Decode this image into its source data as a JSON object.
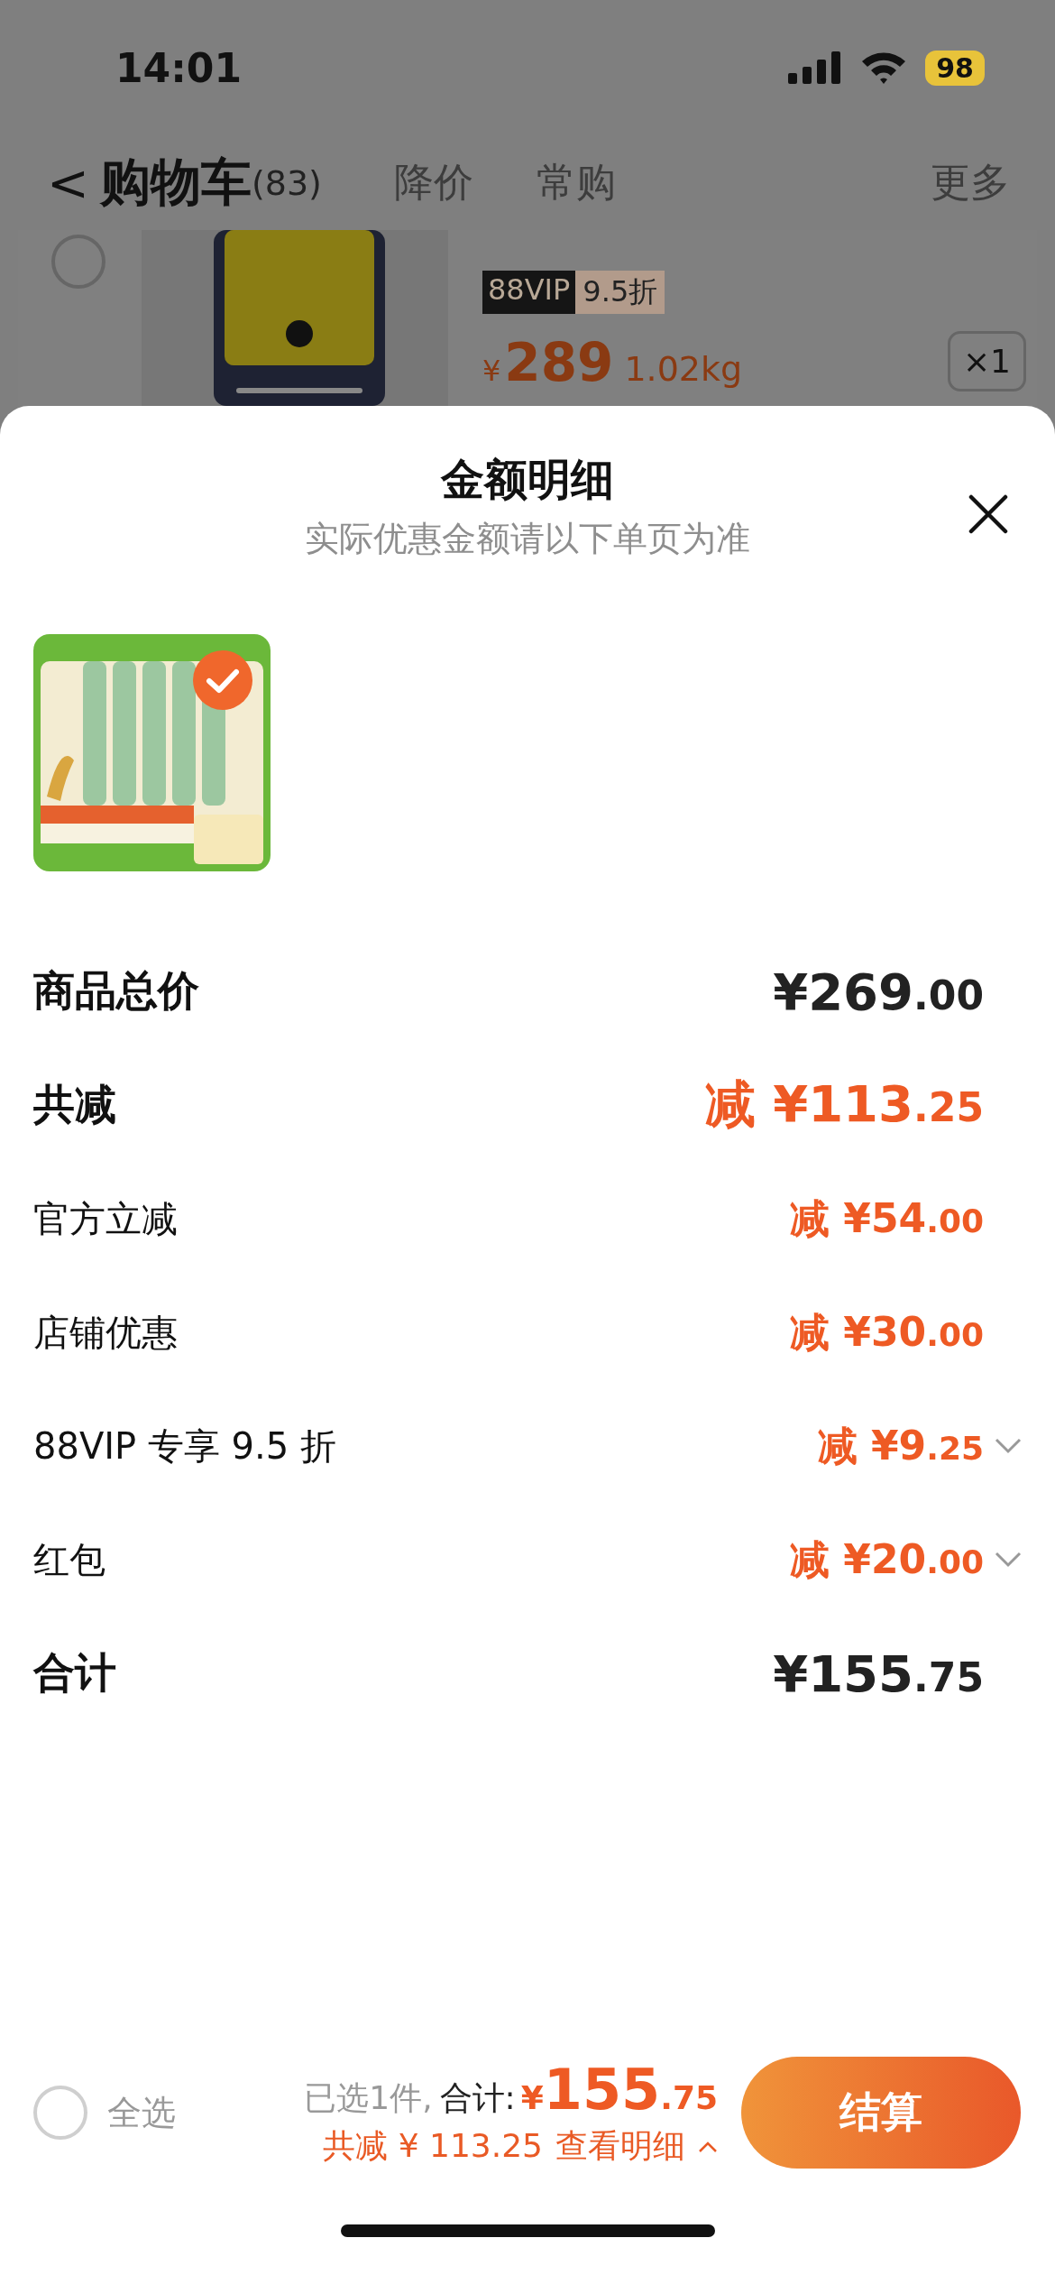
{
  "status_bar": {
    "time": "14:01",
    "battery": "98"
  },
  "nav": {
    "back": "<",
    "title": "购物车",
    "count": "(83)",
    "tabs": [
      {
        "label": "降价",
        "selected": false
      },
      {
        "label": "常购",
        "selected": false
      }
    ],
    "more": "更多"
  },
  "background_item": {
    "selected": false,
    "tag_main": "88VIP",
    "tag_sub": "9.5折",
    "currency": "¥",
    "price": "289",
    "weight": "1.02kg",
    "quantity": "×1"
  },
  "sheet": {
    "title": "金额明细",
    "subtitle": "实际优惠金额请以下单页为准",
    "product": {
      "selected": true
    },
    "rows": [
      {
        "kind": "major",
        "label": "商品总价",
        "prefix": "",
        "main": "¥269",
        "decimal": ".00",
        "discount": false,
        "expandable": false
      },
      {
        "kind": "major",
        "label": "共减",
        "prefix": "减 ",
        "main": "¥113",
        "decimal": ".25",
        "discount": true,
        "expandable": false
      },
      {
        "kind": "minor",
        "label": "官方立减",
        "prefix": "减 ",
        "main": "¥54",
        "decimal": ".00",
        "discount": true,
        "expandable": false
      },
      {
        "kind": "minor",
        "label": "店铺优惠",
        "prefix": "减 ",
        "main": "¥30",
        "decimal": ".00",
        "discount": true,
        "expandable": false
      },
      {
        "kind": "minor",
        "label": "88VIP 专享 9.5 折",
        "prefix": "减 ",
        "main": "¥9",
        "decimal": ".25",
        "discount": true,
        "expandable": true
      },
      {
        "kind": "minor",
        "label": "红包",
        "prefix": "减 ",
        "main": "¥20",
        "decimal": ".00",
        "discount": true,
        "expandable": true
      },
      {
        "kind": "major",
        "label": "合计",
        "prefix": "",
        "main": "¥155",
        "decimal": ".75",
        "discount": false,
        "expandable": false
      }
    ]
  },
  "footer": {
    "select_all": {
      "label": "全选",
      "checked": false
    },
    "selected_text": "已选1件,",
    "total_label": "合计:",
    "total_currency": "¥",
    "total_main": "155",
    "total_decimal": ".75",
    "saving": "共减 ¥ 113.25",
    "details_link": "查看明细",
    "checkout": "结算"
  }
}
